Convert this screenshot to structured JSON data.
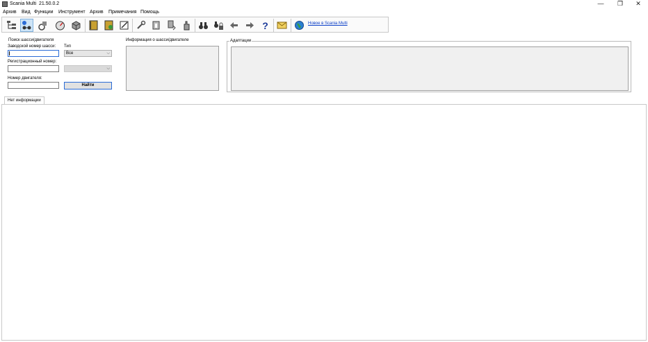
{
  "window": {
    "title": "Scania Multi",
    "version": "21.50.0.2"
  },
  "window_controls": {
    "minimize": "—",
    "restore": "❐",
    "close": "✕"
  },
  "menu": [
    "Архив",
    "Вид",
    "Функции",
    "Инструмент",
    "Архив",
    "Примечания",
    "Помощь"
  ],
  "toolbar": {
    "icons": [
      "tree-view-icon",
      "chassis-search-icon",
      "component-icon",
      "gauge-icon",
      "box-icon",
      "book-icon",
      "book-green-icon",
      "notepad-icon",
      "wrench-icon",
      "part-icon",
      "download-icon",
      "hand-icon",
      "binoculars-icon",
      "lock-binoculars-icon",
      "back-arrow-icon",
      "forward-arrow-icon",
      "help-icon",
      "mail-icon",
      "globe-icon"
    ],
    "news_link": "Новое в Scania Multi"
  },
  "search": {
    "group_label": "Поиск шасси/двигателя",
    "chassis_label": "Заводской номер шасси:",
    "chassis_value": "",
    "type_label": "Тип",
    "type_value": "Все",
    "reg_label": "Регистрационный номер:",
    "reg_value": "",
    "engine_label": "Номер двигателя:",
    "engine_value": "",
    "find_button": "Найти"
  },
  "info": {
    "group_label": "Информация о шасси/двигателе"
  },
  "adaptations": {
    "group_label": "Адаптации"
  },
  "tabs": {
    "no_info": "Нет информации"
  },
  "colors": {
    "accent": "#2a6bd6",
    "link": "#0a3ec8",
    "active_tool": "#cde4f7"
  }
}
